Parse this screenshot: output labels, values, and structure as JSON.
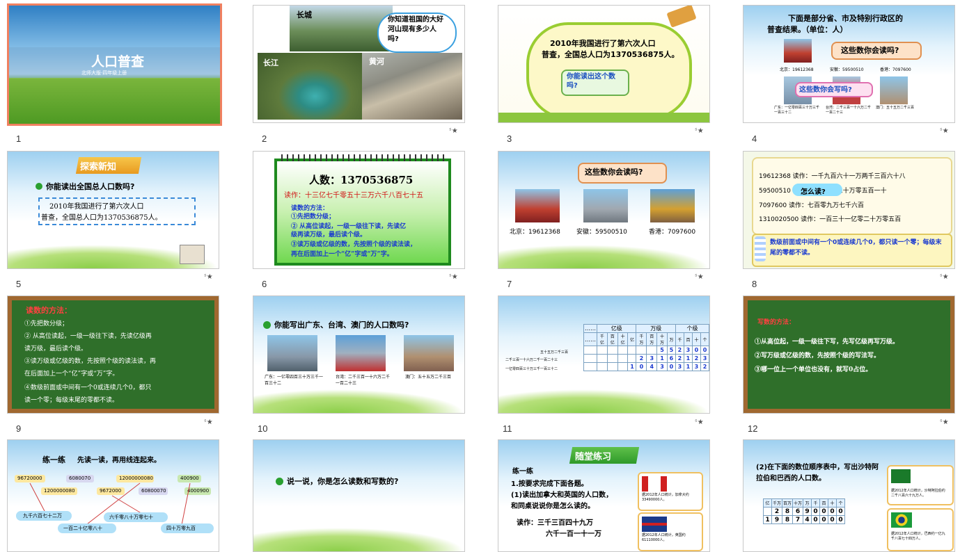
{
  "slides": [
    {
      "num": "1",
      "title": "人口普查",
      "subtitle": "北师大版·四年级上册"
    },
    {
      "num": "2",
      "labels": [
        "长城",
        "长江",
        "黄河"
      ],
      "bubble": "你知道祖国的大好河山现有多少人吗?"
    },
    {
      "num": "3",
      "text_line1": "2010年我国进行了第六次人口",
      "text_line2": "普查，全国总人口为1370536875人。",
      "bubble": "你能读出这个数吗?"
    },
    {
      "num": "4",
      "header_line1": "下面是部分省、市及特别行政区的",
      "header_line2": "普查结果。（单位：人）",
      "q1": "这些数你会读吗?",
      "q2": "这些数你会写吗?",
      "row1": [
        "北京：19612368",
        "安徽：59500510",
        "香港：7097600"
      ],
      "row2": [
        "广东：一亿零四百三十万三千一百三十二",
        "台湾：二千三百一十六万二千一百二十三",
        "澳门：五十五万二千三百"
      ]
    },
    {
      "num": "5",
      "tag": "探索新知",
      "question": "你能读出全国总人口数吗?",
      "box_line1": "2010年我国进行了第六次人口",
      "box_line2": "普查，全国总人口为1370536875人。"
    },
    {
      "num": "6",
      "count": "人数：1370536875",
      "read": "读作：十三亿七千零五十三万六千八百七十五",
      "method_title": "读数的方法：",
      "steps": [
        "①先把数分级；",
        "② 从高位读起，一级一级往下读，先读亿",
        "级再读万级，最后读个级。",
        "③读万级或亿级的数，先按照个级的读法读，",
        "再在后面加上一个“亿”字或“万”字。"
      ]
    },
    {
      "num": "7",
      "q": "这些数你会读吗?",
      "labels": [
        "北京：19612368",
        "安徽：59500510",
        "香港：7097600"
      ]
    },
    {
      "num": "8",
      "rows": [
        "19612368   读作：一千九百六十一万两千三百六十八",
        "59500510   读作：五千九百五十万零五百一十",
        "7097600    读作：七百零九万七千六百",
        "1310020500  读作：一百三十一亿零二十万零五百"
      ],
      "bubble": "怎么读?",
      "rule": "数级前面或中间有一个0或连续几个0，都只读一个零；每级末尾的零都不读。"
    },
    {
      "num": "9",
      "title": "读数的方法：",
      "lines": [
        "①先把数分级；",
        "② 从高位读起，一级一级往下读，先读亿级再",
        "读万级，最后读个级。",
        "③读万级或亿级的数，先按照个级的读法读，再",
        "在后面加上一个“亿”字或“万”字。",
        "④数级前面或中间有一个0或连续几个0，都只",
        "读一个零；每级末尾的零都不读。"
      ]
    },
    {
      "num": "10",
      "question": "你能写出广东、台湾、澳门的人口数吗?",
      "labels": [
        "广东：一亿零四百三十万三千一百三十二",
        "台湾：二千三百一十六万二千一百二十三",
        "澳门：五十五万二千三百"
      ]
    },
    {
      "num": "11",
      "headers": [
        "……",
        "亿级",
        "万级",
        "个级"
      ],
      "places": [
        "千亿",
        "百亿",
        "十亿",
        "亿",
        "千万",
        "百万",
        "十万",
        "万",
        "千",
        "百",
        "十",
        "个"
      ],
      "left": [
        "五十五万二千三百",
        "二千三百一十六万二千一百二十三",
        "一亿零四百三十万三千一百三十二"
      ],
      "rows": [
        [
          "",
          "",
          "",
          "",
          "",
          "",
          "5",
          "5",
          "2",
          "3",
          "0",
          "0"
        ],
        [
          "",
          "",
          "",
          "",
          "2",
          "3",
          "1",
          "6",
          "2",
          "1",
          "2",
          "3"
        ],
        [
          "",
          "",
          "",
          "1",
          "0",
          "4",
          "3",
          "0",
          "3",
          "1",
          "3",
          "2"
        ]
      ]
    },
    {
      "num": "12",
      "title": "写数的方法：",
      "lines": [
        "①从高位起，一级一级往下写，先写亿级再写万级。",
        "②写万级或亿级的数，先按照个级的写法写。",
        "③哪一位上一个单位也没有，就写0占位。"
      ]
    },
    {
      "num": "",
      "tag": "练一练",
      "instr": "先读一读，再用线连起来。",
      "nums": [
        "96720000",
        "6080070",
        "12000000080",
        "400900",
        "1200000080",
        "9672000",
        "60800070",
        "4000900"
      ],
      "words": [
        "九千六百七十二万",
        "六千零八十万零七十",
        "一百二十亿零八十",
        "四十万零九百"
      ]
    },
    {
      "num": "",
      "question": "说一说，你是怎么读数和写数的?"
    },
    {
      "num": "",
      "tag": "随堂练习",
      "sub": "练一练",
      "lines": [
        "1.按要求完成下面各题。",
        "(1)读出加拿大和英国的人口数，",
        "和同桌说说你是怎么读的。"
      ],
      "read": "读作：三千三百四十九万",
      "read2": "六千一百一十一万",
      "card1": "据2012年人口统计，加拿大约33490000人。",
      "card2": "据2012年人口统计，英国约61110000人。"
    },
    {
      "num": "",
      "q": "(2)在下面的数位顺序表中，写出沙特阿拉伯和巴西的人口数。",
      "places": [
        "亿",
        "千万",
        "百万",
        "十万",
        "万",
        "千",
        "百",
        "十",
        "个"
      ],
      "rows": [
        [
          "",
          "2",
          "8",
          "6",
          "9",
          "0",
          "0",
          "0",
          "0"
        ],
        [
          "1",
          "9",
          "8",
          "7",
          "4",
          "0",
          "0",
          "0",
          "0"
        ]
      ],
      "card1": "据2012年人口统计，沙特阿拉伯约二千八百六十九万人。",
      "card2": "据2012年人口统计，巴西约一亿九千八百七十四万人。"
    }
  ]
}
